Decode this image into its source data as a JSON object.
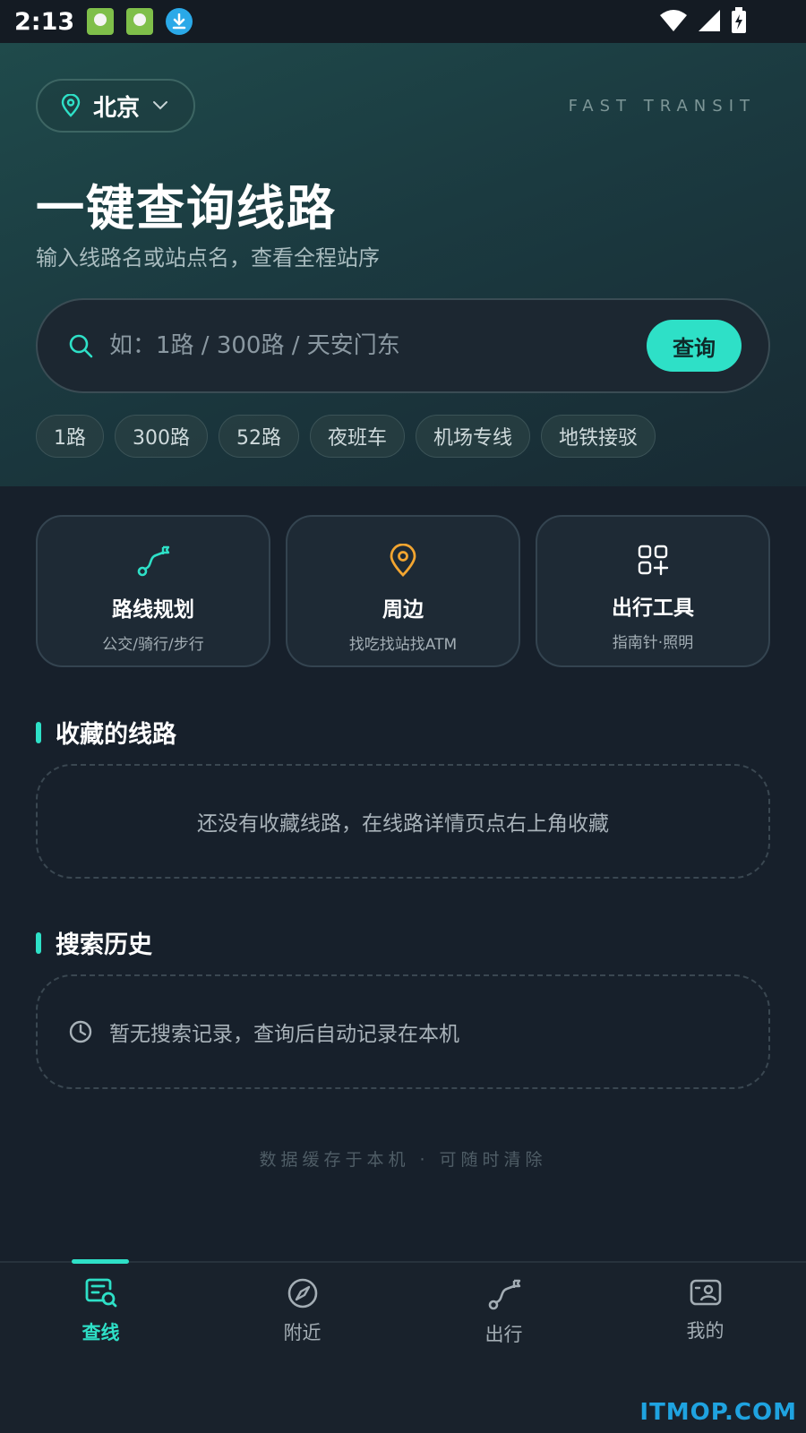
{
  "status_bar": {
    "time": "2:13"
  },
  "header": {
    "city": "北京",
    "brand_tag": "FAST TRANSIT",
    "title": "一键查询线路",
    "subtitle": "输入线路名或站点名，查看全程站序"
  },
  "search": {
    "placeholder": "如：1路 / 300路 / 天安门东",
    "button_label": "查询"
  },
  "chips": [
    "1路",
    "300路",
    "52路",
    "夜班车",
    "机场专线",
    "地铁接驳"
  ],
  "features": [
    {
      "title": "路线规划",
      "subtitle": "公交/骑行/步行",
      "icon": "route-icon"
    },
    {
      "title": "周边",
      "subtitle": "找吃找站找ATM",
      "icon": "location-pin-icon"
    },
    {
      "title": "出行工具",
      "subtitle": "指南针·照明",
      "icon": "grid-plus-icon"
    }
  ],
  "favorites": {
    "title": "收藏的线路",
    "empty_text": "还没有收藏线路，在线路详情页点右上角收藏"
  },
  "history": {
    "title": "搜索历史",
    "empty_text": "暂无搜索记录，查询后自动记录在本机"
  },
  "footer_note": "数据缓存于本机 · 可随时清除",
  "bottom_nav": [
    {
      "label": "查线",
      "icon": "search-line-icon",
      "active": true
    },
    {
      "label": "附近",
      "icon": "compass-icon",
      "active": false
    },
    {
      "label": "出行",
      "icon": "route-icon",
      "active": false
    },
    {
      "label": "我的",
      "icon": "profile-card-icon",
      "active": false
    }
  ],
  "watermark": "ITMOP.COM",
  "colors": {
    "accent": "#2ee0c7",
    "pin_orange": "#f3a530",
    "background": "#17202b"
  }
}
